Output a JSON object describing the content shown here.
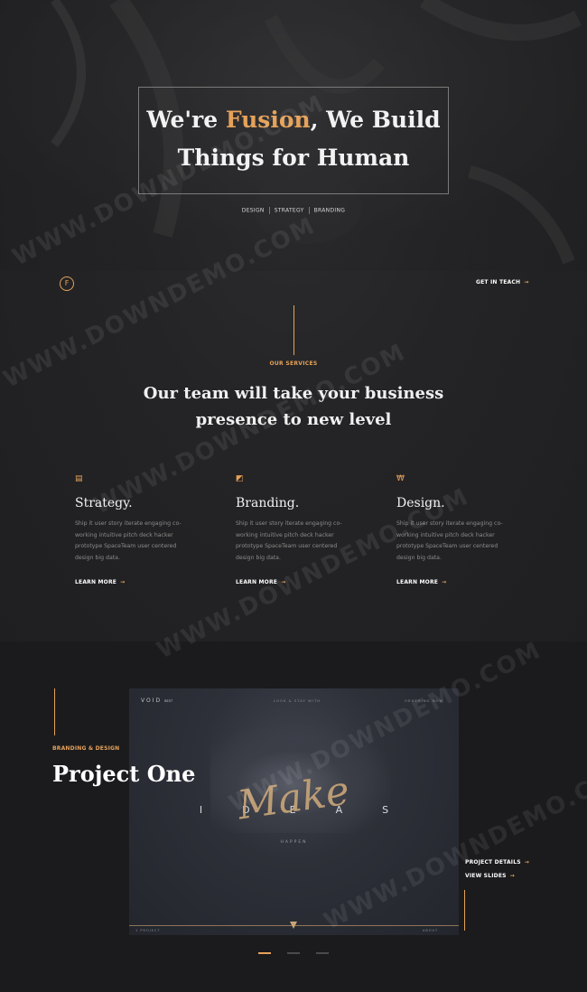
{
  "hero": {
    "title_part1": "We're ",
    "title_accent": "Fusion",
    "title_part2": ", We Build",
    "title_line2": "Things for Human",
    "tags": [
      "DESIGN",
      "STRATEGY",
      "BRANDING"
    ]
  },
  "logo_letter": "F",
  "cta": {
    "label": "GET IN TEACH",
    "arrow": "→"
  },
  "services": {
    "label": "OUR SERVICES",
    "title_line1": "Our team will take your business",
    "title_line2": "presence to new level",
    "items": [
      {
        "icon": "document-icon",
        "glyph": "▤",
        "title": "Strategy.",
        "text": "Ship it user story iterate engaging co-working intuitive pitch deck hacker prototype SpaceTeam user centered design big data.",
        "more": "LEARN MORE",
        "arrow": "→"
      },
      {
        "icon": "pencil-icon",
        "glyph": "◩",
        "title": "Branding.",
        "text": "Ship it user story iterate engaging co-working intuitive pitch deck hacker prototype SpaceTeam user centered design big data.",
        "more": "LEARN MORE",
        "arrow": "→"
      },
      {
        "icon": "brush-icon",
        "glyph": "₩",
        "title": "Design.",
        "text": "Ship it user story iterate engaging co-working intuitive pitch deck hacker prototype SpaceTeam user centered design big data.",
        "more": "LEARN MORE",
        "arrow": "→"
      }
    ]
  },
  "project": {
    "label": "BRANDING & DESIGN",
    "title": "Project One",
    "details_label": "PROJECT DETAILS",
    "slides_label": "VIEW SLIDES",
    "arrow": "→",
    "shot": {
      "logo": "VOID",
      "logo_sub": "BEST",
      "nav_center": "LOOK & STAY WITH",
      "nav_right": "ORDERING NOW",
      "ideas": "IDEAS",
      "make": "Make",
      "happen": "HAPPEN",
      "bottom_left": "1 PROJECT",
      "bottom_right": "ABOUT"
    }
  },
  "watermark_text": "WWW.DOWNDEMO.COM",
  "colors": {
    "accent": "#e5a25a",
    "bg": "#1f1f21"
  }
}
